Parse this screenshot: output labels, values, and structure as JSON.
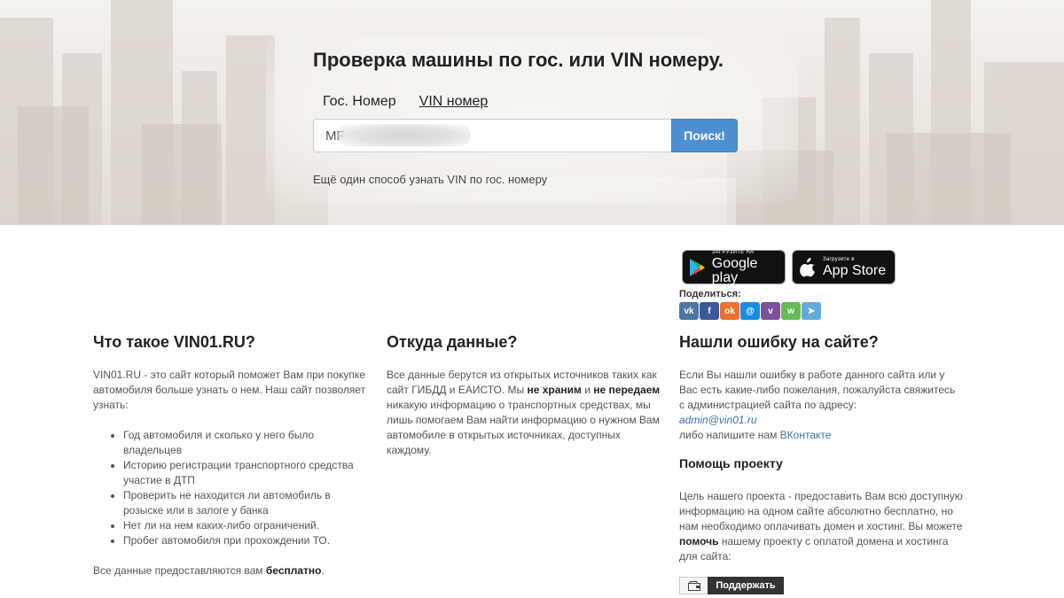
{
  "hero": {
    "title": "Проверка машины по гос. или VIN номеру.",
    "tabs": [
      {
        "label": "Гос. Номер",
        "active": false
      },
      {
        "label": "VIN номер",
        "active": true
      }
    ],
    "search_value": "MF",
    "search_button": "Поиск!",
    "alt_link": "Ещё один способ узнать VIN по гос. номеру"
  },
  "stores": {
    "google": {
      "small": "ЗАГРУЗИТЕ НА",
      "big": "Google play",
      "icon": "google-play-icon"
    },
    "apple": {
      "small": "Загрузите в",
      "big": "App Store",
      "icon": "apple-icon"
    }
  },
  "share": {
    "label": "Поделиться:",
    "icons": [
      {
        "name": "vk-share-icon",
        "glyph": "vk",
        "color": "#4c75a3"
      },
      {
        "name": "facebook-share-icon",
        "glyph": "f",
        "color": "#3b5998"
      },
      {
        "name": "odnoklassniki-share-icon",
        "glyph": "ok",
        "color": "#eb722e"
      },
      {
        "name": "moimir-share-icon",
        "glyph": "@",
        "color": "#168de2"
      },
      {
        "name": "viber-share-icon",
        "glyph": "v",
        "color": "#7b519d"
      },
      {
        "name": "whatsapp-share-icon",
        "glyph": "w",
        "color": "#65bc54"
      },
      {
        "name": "telegram-share-icon",
        "glyph": "➤",
        "color": "#64a9dc"
      }
    ]
  },
  "about": {
    "title": "Что такое VIN01.RU?",
    "intro": "VIN01.RU - это сайт который поможет Вам при покупке автомобиля больше узнать о нем. Наш сайт позволяет узнать:",
    "items": [
      "Год автомобиля и сколько у него было владельцев",
      "Историю регистрации транспортного средства участие в ДТП",
      "Проверить не находится ли автомобиль в розыске или в залоге у банка",
      "Нет ли на нем каких-либо ограничений.",
      "Пробег автомобиля при прохождении ТО."
    ],
    "footer_pre": "Все данные предоставляются вам ",
    "footer_bold": "бесплатно",
    "footer_post": "."
  },
  "source": {
    "title": "Откуда данные?",
    "t1": "Все данные берутся из открытых источников таких как сайт ГИБДД и ЕАИСТО. Мы ",
    "b1": "не храним",
    "t2": " и ",
    "b2": "не передаем",
    "t3": " никакую информацию о транспортных средствах, мы лишь помогаем Вам найти информацию о нужном Вам автомобиле в открытых источниках, доступных каждому."
  },
  "error": {
    "title": "Нашли ошибку на сайте?",
    "text": "Если Вы нашли ошибку в работе данного сайта или у Вас есть какие-либо пожелания, пожалуйста свяжитесь с администрацией сайта по адресу:",
    "email": "admin@vin01.ru",
    "or_text": "либо напишите нам ",
    "vk_link": "ВКонтакте",
    "help_title": "Помощь проекту",
    "help_t1": "Цель нашего проекта - предоставить Вам всю доступную информацию на одном сайте абсолютно бесплатно, но нам необходимо оплачивать домен и хостинг. Вы можете ",
    "help_bold": "помочь",
    "help_t2": " нашему проекту с оплатой домена и хостинга для сайта:",
    "support_button": "Поддержать",
    "support_icon": "wallet-icon"
  }
}
